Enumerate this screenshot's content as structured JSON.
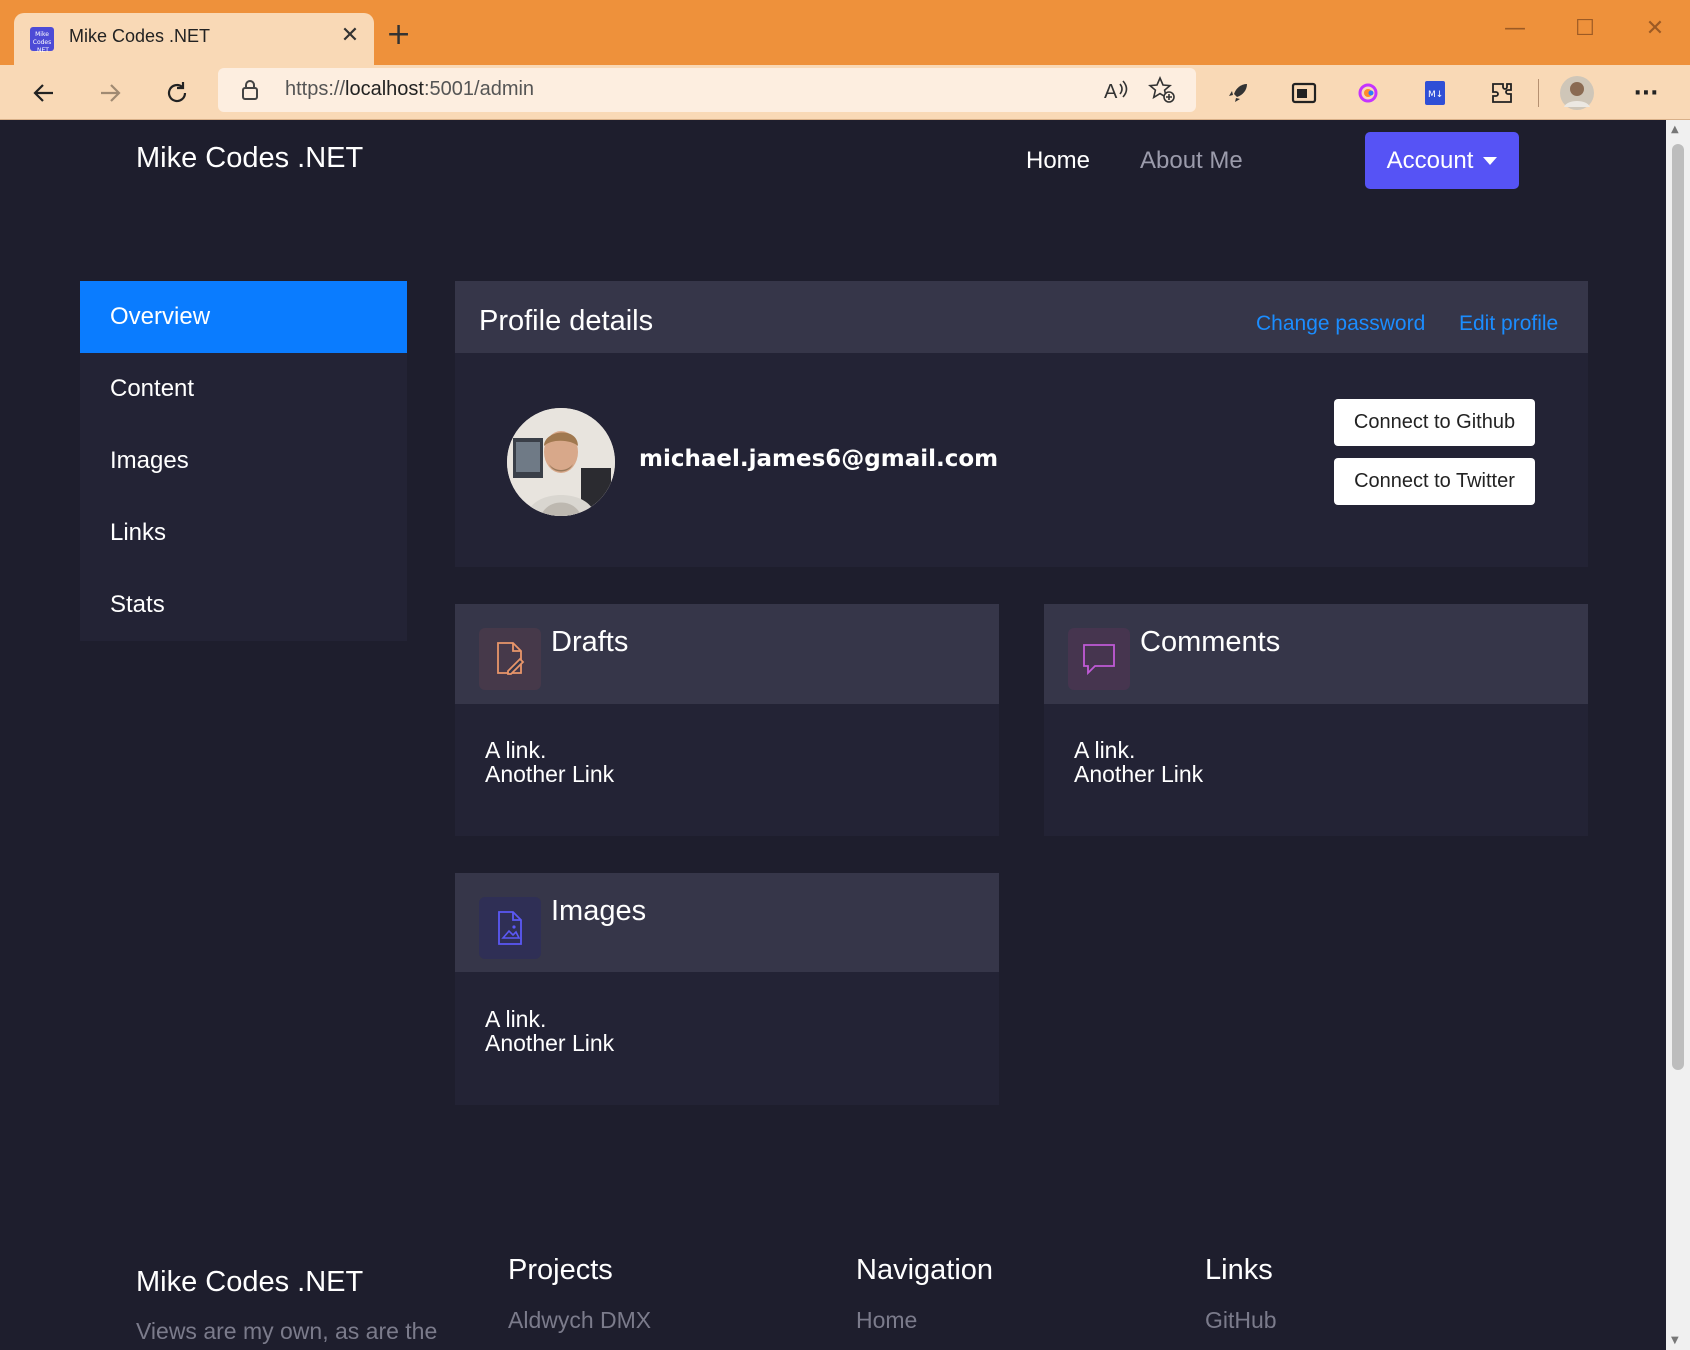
{
  "browser": {
    "tab_title": "Mike Codes .NET",
    "favicon_text": "Mike Codes .NET",
    "url_prefix": "https://",
    "url_host": "localhost",
    "url_rest": ":5001/admin",
    "new_tab": "+",
    "close_tab": "✕",
    "more": "···"
  },
  "navbar": {
    "brand": "Mike Codes .NET",
    "links": [
      "Home",
      "About Me"
    ],
    "account_label": "Account"
  },
  "sidebar": {
    "items": [
      "Overview",
      "Content",
      "Images",
      "Links",
      "Stats"
    ],
    "active": "Overview"
  },
  "profile": {
    "title": "Profile details",
    "change_password": "Change password",
    "edit_profile": "Edit profile",
    "email": "michael.james6@gmail.com",
    "connect_github": "Connect to Github",
    "connect_twitter": "Connect to Twitter"
  },
  "cards": [
    {
      "title": "Drafts",
      "icon": "document-edit-icon",
      "color": "#e8956a",
      "links": [
        "A link.",
        "Another Link"
      ]
    },
    {
      "title": "Comments",
      "icon": "comment-icon",
      "color": "#c05ad6",
      "links": [
        "A link.",
        "Another Link"
      ]
    },
    {
      "title": "Images",
      "icon": "image-file-icon",
      "color": "#5b58f5",
      "links": [
        "A link.",
        "Another Link"
      ]
    }
  ],
  "footer": {
    "brand": "Mike Codes .NET",
    "tagline": "Views are my own, as are the",
    "columns": [
      {
        "heading": "Projects",
        "link": "Aldwych DMX"
      },
      {
        "heading": "Navigation",
        "link": "Home"
      },
      {
        "heading": "Links",
        "link": "GitHub"
      }
    ]
  },
  "colors": {
    "page_bg": "#1e1e2d",
    "card_bg": "#232335",
    "card_head": "#363649",
    "primary": "#0a7cff",
    "account": "#5653f5",
    "browser_accent": "#ee913b"
  }
}
